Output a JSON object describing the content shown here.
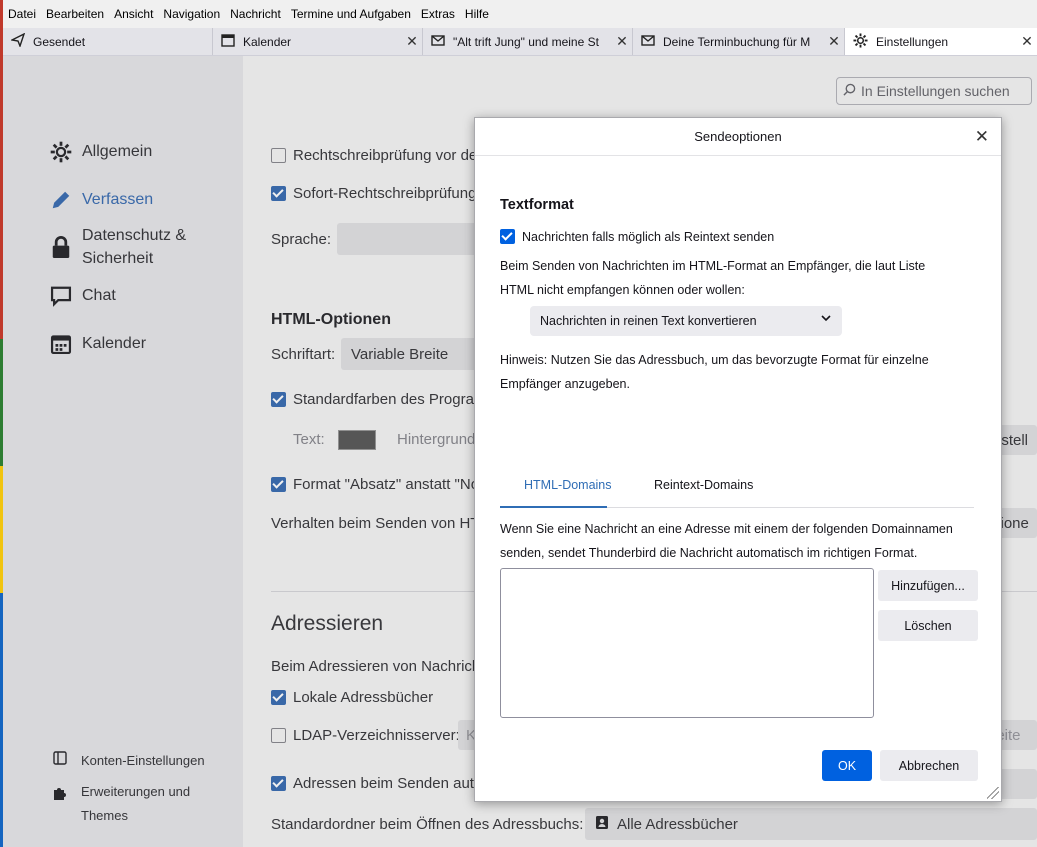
{
  "menubar": [
    "Datei",
    "Bearbeiten",
    "Ansicht",
    "Navigation",
    "Nachricht",
    "Termine und Aufgaben",
    "Extras",
    "Hilfe"
  ],
  "tabs": [
    {
      "title": "Gesendet",
      "icon": "send-icon",
      "closable": false
    },
    {
      "title": "Kalender",
      "icon": "calendar-icon",
      "closable": true
    },
    {
      "title": "\"Alt trift Jung\" und meine St",
      "icon": "mail-icon",
      "closable": true
    },
    {
      "title": "Deine Terminbuchung für M",
      "icon": "mail-icon",
      "closable": true
    },
    {
      "title": "Einstellungen",
      "icon": "gear-icon",
      "closable": true,
      "active": true
    }
  ],
  "search": {
    "placeholder": "In Einstellungen suchen"
  },
  "sidebar": {
    "items": [
      {
        "label": "Allgemein",
        "icon": "gear-icon"
      },
      {
        "label": "Verfassen",
        "icon": "pencil-icon",
        "active": true
      },
      {
        "label": "Datenschutz &",
        "label2": "Sicherheit",
        "icon": "lock-icon"
      },
      {
        "label": "Chat",
        "icon": "chat-icon"
      },
      {
        "label": "Kalender",
        "icon": "calendar-icon"
      }
    ],
    "bottom": [
      {
        "label": "Konten-Einstellungen",
        "icon": "account-icon"
      },
      {
        "label": "Erweiterungen und",
        "label2": "Themes",
        "icon": "puzzle-icon"
      }
    ]
  },
  "content": {
    "spell_check": "Rechtschreibprüfung vor de",
    "instant_spell": "Sofort-Rechtschreibprüfung",
    "language_label": "Sprache:",
    "html_options_title": "HTML-Optionen",
    "font_label": "Schriftart:",
    "font_value": "Variable Breite",
    "default_colors": "Standardfarben des Program",
    "text_label": "Text:",
    "background_label": "Hintergrund",
    "right_edge_1": "erstell",
    "format_para": "Format \"Absatz\" anstatt \"No",
    "send_behavior": "Verhalten beim Senden von HT",
    "right_edge_2": "ptione",
    "addressing_title": "Adressieren",
    "addressing_desc": "Beim Adressieren von Nachrich",
    "local_books": "Lokale Adressbücher",
    "ldap": "LDAP-Verzeichnisserver:",
    "ldap_select": "K",
    "right_edge_3": "beite",
    "auto_add": "Adressen beim Senden auto",
    "default_folder_label": "Standardordner beim Öffnen des Adressbuchs:",
    "default_folder_value": "Alle Adressbücher"
  },
  "dialog": {
    "title": "Sendeoptionen",
    "section_title": "Textformat",
    "plaintext_checkbox": "Nachrichten falls möglich als Reintext senden",
    "desc_line1": "Beim Senden von Nachrichten im HTML-Format an Empfänger, die laut Liste",
    "desc_line2": "HTML nicht empfangen können oder wollen:",
    "select_value": "Nachrichten in reinen Text konvertieren",
    "hint_line1": "Hinweis: Nutzen Sie das Adressbuch, um das bevorzugte Format für einzelne",
    "hint_line2": "Empfänger anzugeben.",
    "tab_html": "HTML-Domains",
    "tab_plain": "Reintext-Domains",
    "domains_line1": "Wenn Sie eine Nachricht an eine Adresse mit einem der folgenden Domainnamen",
    "domains_line2": "senden, sendet Thunderbird die Nachricht automatisch im richtigen Format.",
    "add_button": "Hinzufügen...",
    "delete_button": "Löschen",
    "ok_button": "OK",
    "cancel_button": "Abbrechen"
  },
  "colors": {
    "accent": "#0061e0",
    "nav_active": "#3d6fb3"
  }
}
